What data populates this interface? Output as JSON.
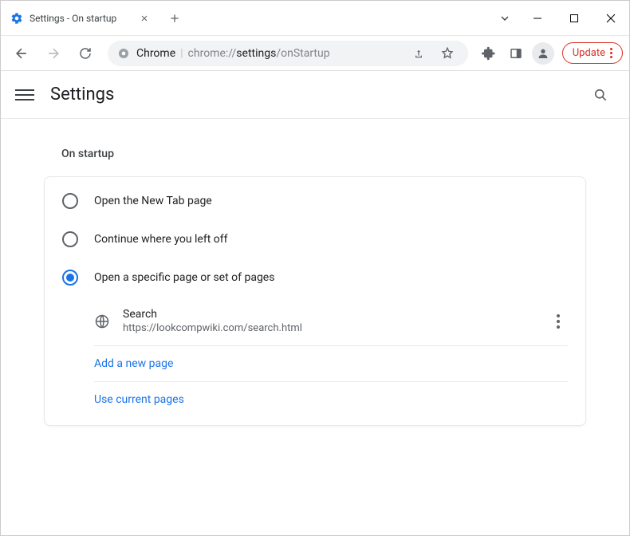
{
  "tab": {
    "title": "Settings - On startup"
  },
  "omnibox": {
    "chrome_label": "Chrome",
    "url_prefix": "chrome://",
    "url_bold": "settings",
    "url_suffix": "/onStartup"
  },
  "update_label": "Update",
  "page": {
    "title": "Settings",
    "section_title": "On startup"
  },
  "radios": {
    "option1": "Open the New Tab page",
    "option2": "Continue where you left off",
    "option3": "Open a specific page or set of pages",
    "selected": 3
  },
  "page_entry": {
    "title": "Search",
    "url": "https://lookcompwiki.com/search.html"
  },
  "links": {
    "add_page": "Add a new page",
    "use_current": "Use current pages"
  }
}
